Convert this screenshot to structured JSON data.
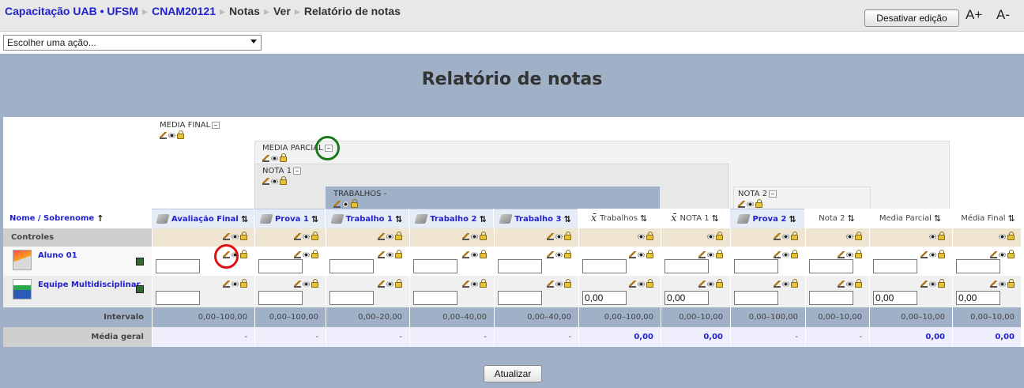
{
  "breadcrumb": {
    "site": "Capacitação UAB • UFSM",
    "course": "CNAM20121",
    "notas": "Notas",
    "ver": "Ver",
    "current": "Relatório de notas"
  },
  "toolbar": {
    "edit_toggle": "Desativar edição",
    "font_increase": "A+",
    "font_decrease": "A-"
  },
  "action_select": {
    "value": "Escolher uma ação..."
  },
  "page": {
    "title": "Relatório de notas"
  },
  "categories": {
    "media_final": "MEDIA FINAL",
    "media_parcial": "MEDIA PARCIAL",
    "nota1": "NOTA 1",
    "trabalhos": "TRABALHOS -",
    "nota2": "NOTA 2"
  },
  "columns": {
    "name": "Nome / Sobrenome",
    "headers": [
      "Avaliação Final",
      "Prova 1",
      "Trabalho 1",
      "Trabalho 2",
      "Trabalho 3",
      "Trabalhos",
      "NOTA 1",
      "Prova 2",
      "Nota 2",
      "Media Parcial",
      "Média Final"
    ]
  },
  "rows": {
    "controles": "Controles",
    "students": [
      {
        "name": "Aluno 01",
        "values": [
          "",
          "",
          "",
          "",
          "",
          "",
          "",
          "",
          "",
          "",
          ""
        ]
      },
      {
        "name": "Equipe Multidisciplinar",
        "values": [
          "",
          "",
          "",
          "",
          "",
          "0,00",
          "0,00",
          "",
          "",
          "0,00",
          "0,00"
        ]
      }
    ],
    "intervalo": {
      "label": "Intervalo",
      "values": [
        "0,00–100,00",
        "0,00–100,00",
        "0,00–20,00",
        "0,00–40,00",
        "0,00–40,00",
        "0,00–100,00",
        "0,00–10,00",
        "0,00–100,00",
        "0,00–10,00",
        "0,00–10,00",
        "0,00–10,00"
      ]
    },
    "media_geral": {
      "label": "Média geral",
      "values": [
        "-",
        "-",
        "-",
        "-",
        "-",
        "0,00",
        "0,00",
        "-",
        "-",
        "0,00",
        "0,00"
      ]
    }
  },
  "update_button": "Atualizar"
}
